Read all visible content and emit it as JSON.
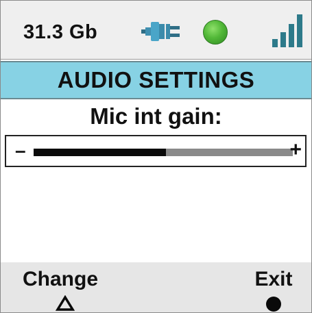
{
  "status_bar": {
    "storage": "31.3 Gb",
    "connection_icon": "plug-icon",
    "led_icon": "status-led-icon",
    "led_color": "#4cb535",
    "signal_icon": "signal-bars-icon",
    "signal_color": "#2d7a8a"
  },
  "title_bar": {
    "title": "AUDIO SETTINGS",
    "background": "#87d2e4"
  },
  "parameter": {
    "label": "Mic int gain:",
    "minus_label": "–",
    "plus_label": "+",
    "level_fraction": 0.51
  },
  "soft_keys": {
    "left_label": "Change",
    "left_icon": "triangle-icon",
    "right_label": "Exit",
    "right_icon": "circle-icon"
  }
}
